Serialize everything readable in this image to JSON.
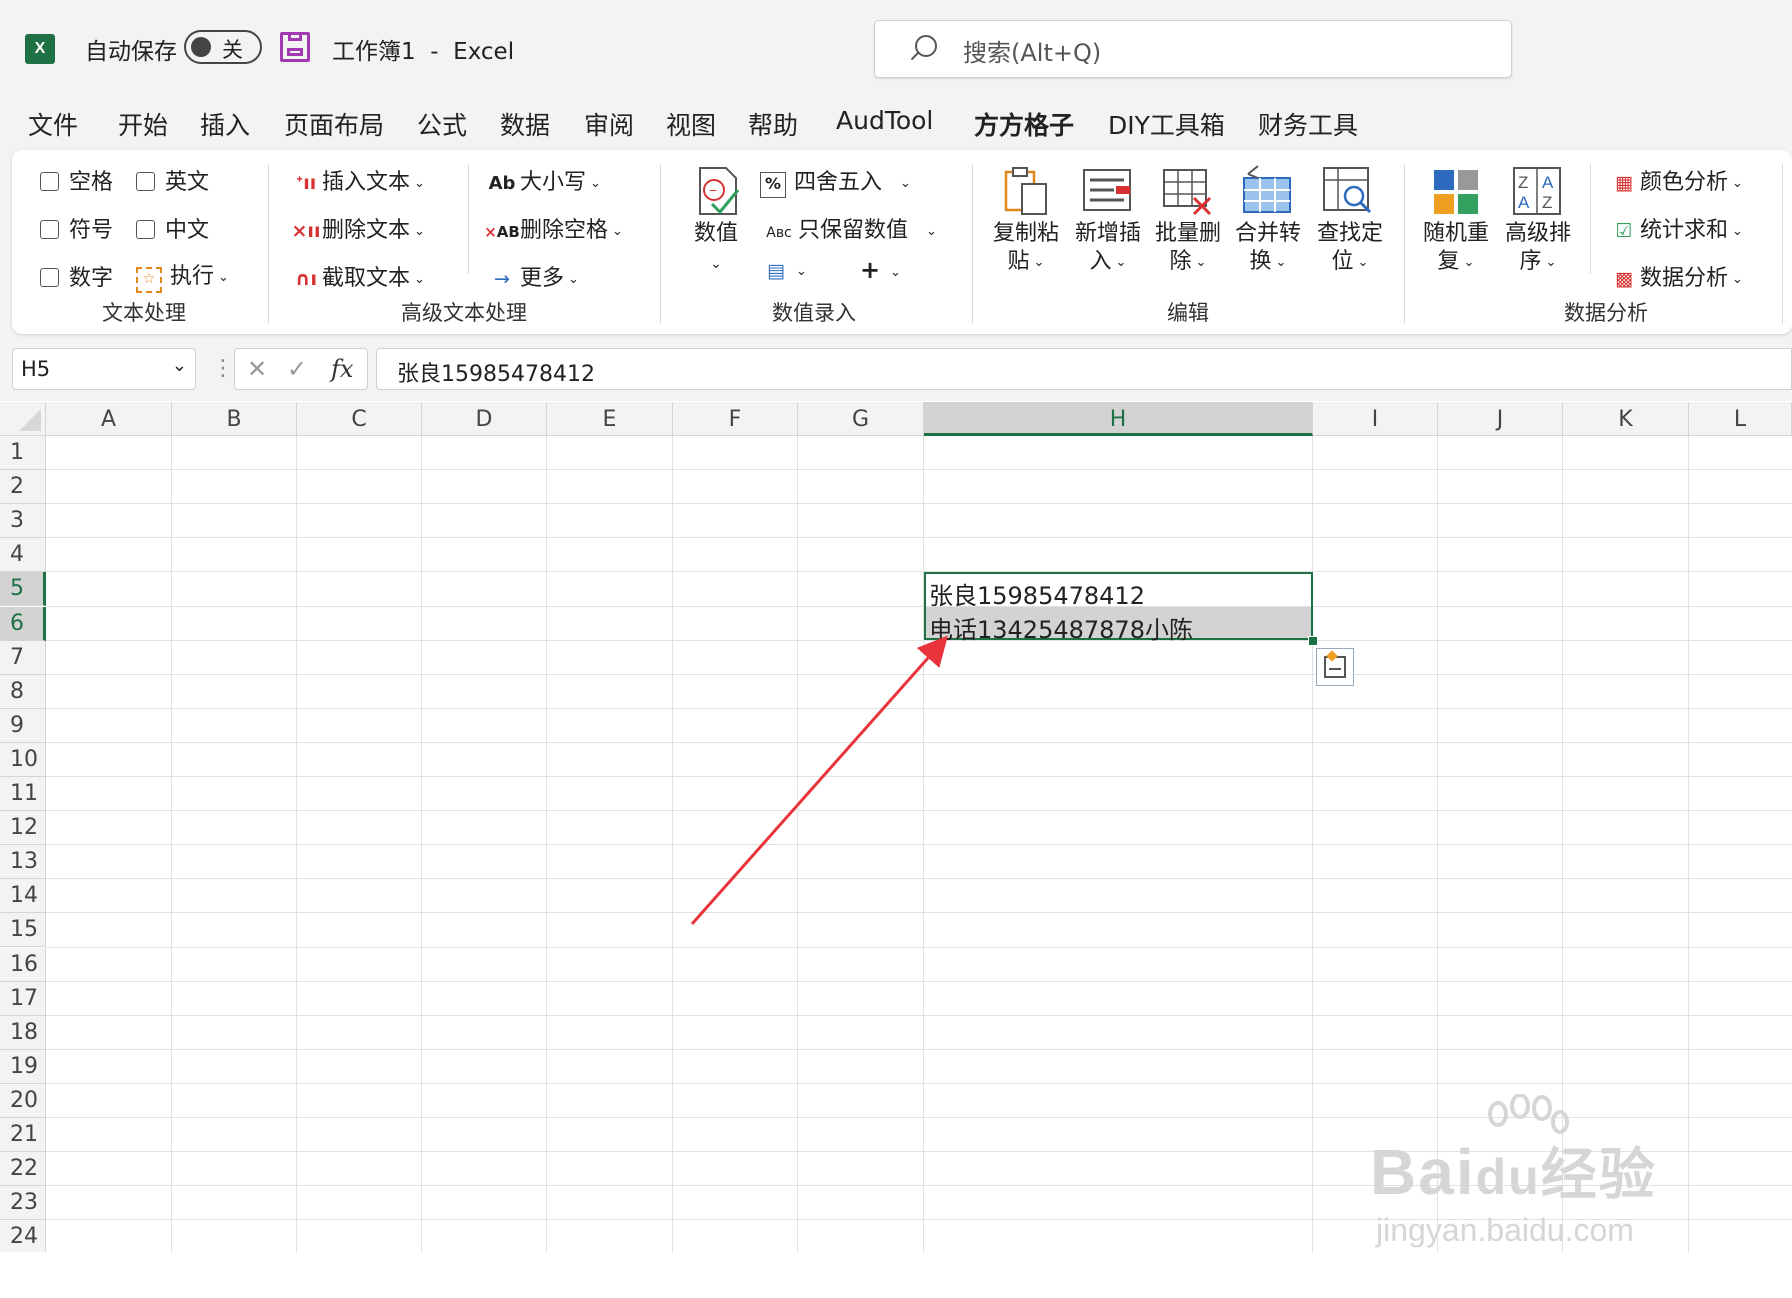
{
  "titlebar": {
    "app_icon": "excel-icon",
    "autosave_label": "自动保存",
    "toggle_state": "关",
    "save_icon": "save-icon",
    "document_title": "工作簿1  -  Excel",
    "search_placeholder": "搜索(Alt+Q)"
  },
  "tabs": [
    "文件",
    "开始",
    "插入",
    "页面布局",
    "公式",
    "数据",
    "审阅",
    "视图",
    "帮助",
    "AudTool",
    "方方格子",
    "DIY工具箱",
    "财务工具"
  ],
  "active_tab": "方方格子",
  "ribbon": {
    "text_group": {
      "label": "文本处理",
      "checkboxes": [
        "空格",
        "英文",
        "符号",
        "中文",
        "数字"
      ],
      "execute": "执行"
    },
    "advanced_text_group": {
      "label": "高级文本处理",
      "items": [
        "插入文本",
        "删除文本",
        "截取文本",
        "大小写",
        "删除空格",
        "更多"
      ]
    },
    "numeric_group": {
      "label": "数值录入",
      "big_button": "数值",
      "items": [
        "四舍五入",
        "只保留数值"
      ]
    },
    "edit_group": {
      "label": "编辑",
      "buttons": [
        {
          "line1": "复制粘",
          "line2": "贴"
        },
        {
          "line1": "新增插",
          "line2": "入"
        },
        {
          "line1": "批量删",
          "line2": "除"
        },
        {
          "line1": "合并转",
          "line2": "换"
        },
        {
          "line1": "查找定",
          "line2": "位"
        }
      ]
    },
    "analysis_group": {
      "label": "数据分析",
      "buttons": [
        {
          "line1": "随机重",
          "line2": "复"
        },
        {
          "line1": "高级排",
          "line2": "序"
        }
      ],
      "items": [
        "颜色分析",
        "统计求和",
        "数据分析"
      ]
    }
  },
  "formula_bar": {
    "name_box": "H5",
    "fx_label": "fx",
    "formula": "张良15985478412"
  },
  "sheet": {
    "columns": [
      "A",
      "B",
      "C",
      "D",
      "E",
      "F",
      "G",
      "H",
      "I",
      "J",
      "K",
      "L"
    ],
    "rows": [
      "1",
      "2",
      "3",
      "4",
      "5",
      "6",
      "7",
      "8",
      "9",
      "10",
      "11",
      "12",
      "13",
      "14",
      "15",
      "16",
      "17",
      "18",
      "19",
      "20",
      "21",
      "22",
      "23",
      "24"
    ],
    "selected_column": "H",
    "selected_rows": [
      "5",
      "6"
    ],
    "cells": {
      "H5": "张良15985478412",
      "H6": "电话13425487878小陈"
    }
  },
  "watermark": {
    "brand": "Bai",
    "brand_tail": "du",
    "brand_cn": "经验",
    "url": "jingyan.baidu.com"
  },
  "colors": {
    "excel_green": "#1e7145",
    "arrow_red": "#e8343a",
    "save_purple": "#a13ab0"
  }
}
